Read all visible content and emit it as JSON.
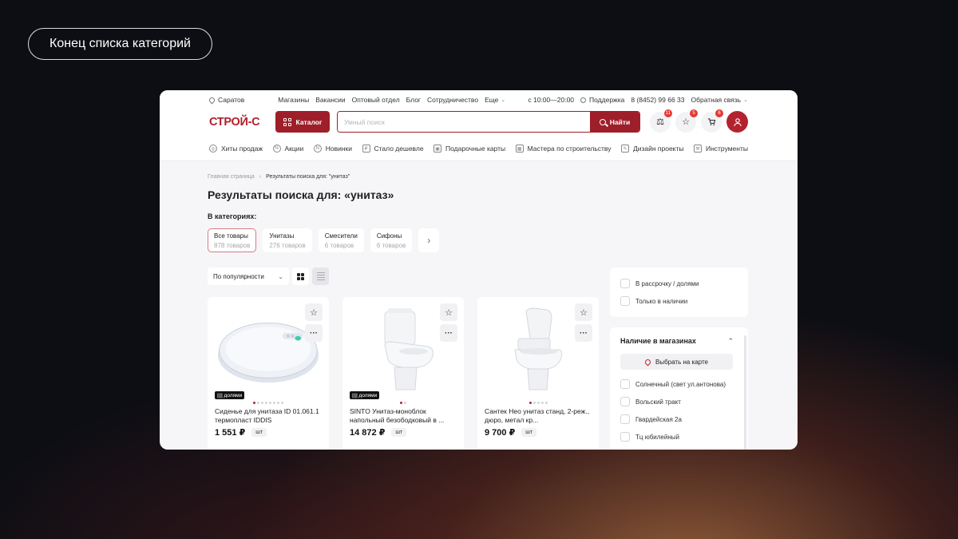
{
  "overlay": {
    "label": "Конец списка категорий"
  },
  "topbar": {
    "city": "Саратов",
    "links": [
      "Магазины",
      "Вакансии",
      "Оптовый отдел",
      "Блог",
      "Сотрудничество"
    ],
    "more": "Еще",
    "hours": "с 10:00—20:00",
    "support": "Поддержка",
    "phone": "8 (8452) 99 66 33",
    "feedback": "Обратная связь"
  },
  "header": {
    "logo": "СТРОЙ-С",
    "catalog_label": "Каталог",
    "search_placeholder": "Умный поиск",
    "search_button": "Найти",
    "compare_count": "11",
    "favorites_count": "5",
    "cart_count": "6"
  },
  "nav": [
    {
      "label": "Хиты продаж",
      "icon": "fire-icon"
    },
    {
      "label": "Акции",
      "icon": "percent-icon"
    },
    {
      "label": "Новинки",
      "icon": "new-icon"
    },
    {
      "label": "Стало дешевле",
      "icon": "price-down-icon"
    },
    {
      "label": "Подарочные карты",
      "icon": "gift-icon"
    },
    {
      "label": "Мастера по строительству",
      "icon": "calendar-icon"
    },
    {
      "label": "Дизайн проекты",
      "icon": "pencil-icon"
    },
    {
      "label": "Инструменты",
      "icon": "drill-icon"
    }
  ],
  "breadcrumb": {
    "home": "Главная страница",
    "current": "Результаты поиска для: \"унитаз\""
  },
  "page": {
    "title": "Результаты поиска для: «унитаз»",
    "categories_label": "В категориях:"
  },
  "categories": [
    {
      "name": "Все товары",
      "count": "878 товаров"
    },
    {
      "name": "Унитазы",
      "count": "276 товаров"
    },
    {
      "name": "Смесители",
      "count": "6 товаров"
    },
    {
      "name": "Сифоны",
      "count": "6 товаров"
    }
  ],
  "sort": {
    "selected": "По популярности"
  },
  "products": [
    {
      "name": "Сиденье для унитаза ID 01.061.1 термопласт IDDIS",
      "price": "1 551 ₽",
      "unit": "шт",
      "installment": "|||| долями"
    },
    {
      "name": "SINTO Унитаз-моноблок напольный безободковый в ...",
      "price": "14 872 ₽",
      "unit": "шт",
      "installment": "|||| долями"
    },
    {
      "name": "Сантек Нео унитаз станд, 2-реж., дюро, метал кр...",
      "price": "9 700 ₽",
      "unit": "шт",
      "installment": ""
    }
  ],
  "filters": {
    "installment": "В рассрочку / долями",
    "in_stock": "Только в наличии",
    "stores_title": "Наличие в магазинах",
    "map_button": "Выбрать на карте",
    "stores": [
      "Солнечный (свет ул.антонова)",
      "Вольский тракт",
      "Гвардейская 2а",
      "Тц юбилейный"
    ]
  },
  "colors": {
    "brand": "#9e1f2a",
    "badge": "#e53935"
  }
}
